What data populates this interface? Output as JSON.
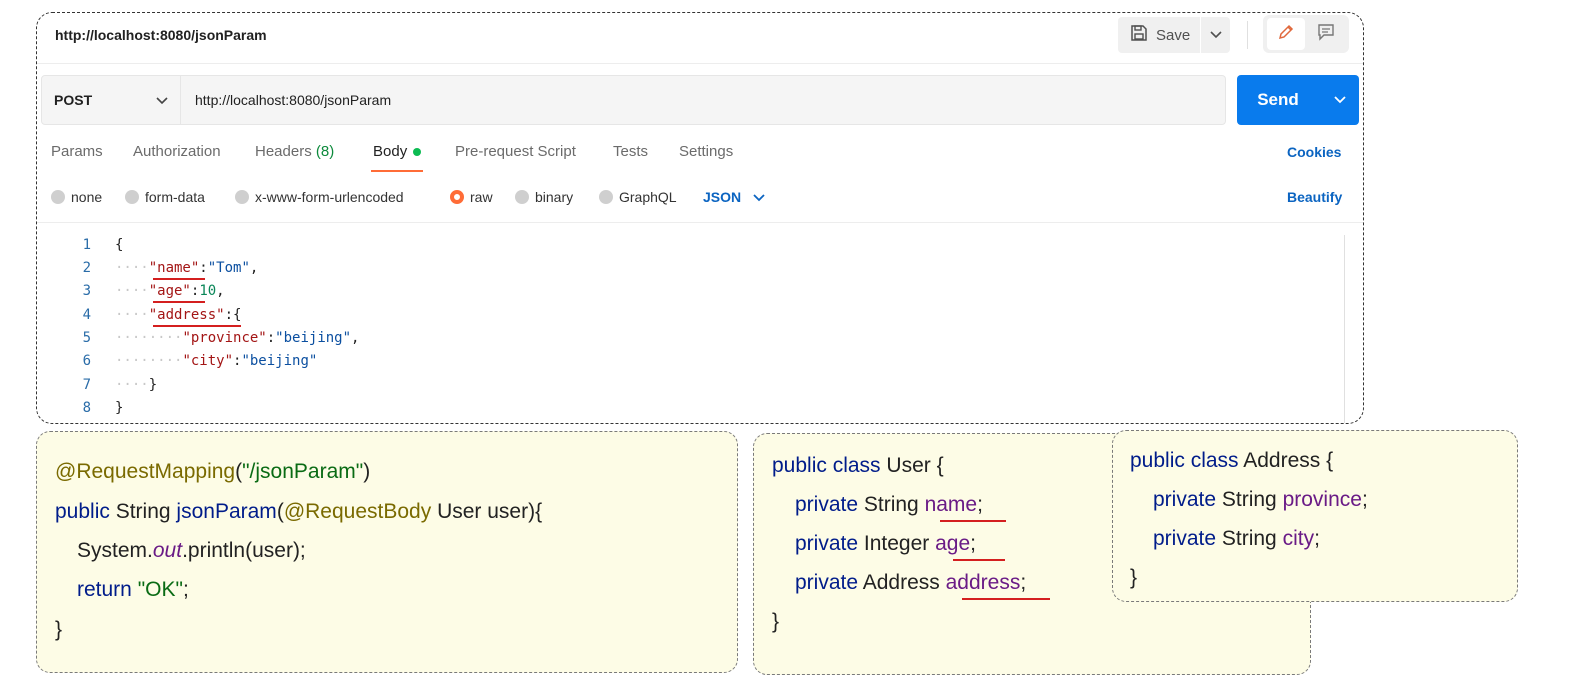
{
  "request": {
    "title": "http://localhost:8080/jsonParam",
    "method": "POST",
    "url": "http://localhost:8080/jsonParam",
    "save_label": "Save",
    "send_label": "Send"
  },
  "tabs": [
    {
      "label": "Params"
    },
    {
      "label": "Authorization"
    },
    {
      "label": "Headers",
      "count": "(8)"
    },
    {
      "label": "Body",
      "active": true
    },
    {
      "label": "Pre-request Script"
    },
    {
      "label": "Tests"
    },
    {
      "label": "Settings"
    }
  ],
  "cookies_label": "Cookies",
  "body_types": [
    {
      "label": "none"
    },
    {
      "label": "form-data"
    },
    {
      "label": "x-www-form-urlencoded"
    },
    {
      "label": "raw",
      "selected": true
    },
    {
      "label": "binary"
    },
    {
      "label": "GraphQL"
    }
  ],
  "format_label": "JSON",
  "beautify_label": "Beautify",
  "editor": {
    "line_numbers": [
      "1",
      "2",
      "3",
      "4",
      "5",
      "6",
      "7",
      "8"
    ],
    "tokens": {
      "open": "{",
      "name_key": "\"name\"",
      "name_val": "\"Tom\"",
      "age_key": "\"age\"",
      "age_val": "10",
      "address_key": "\"address\"",
      "province_key": "\"province\"",
      "province_val": "\"beijing\"",
      "city_key": "\"city\"",
      "city_val": "\"beijing\"",
      "close_inner": "}",
      "close": "}"
    }
  },
  "controller_code": {
    "annotation": "@RequestMapping",
    "mapping_path": "\"/jsonParam\"",
    "kw_public": "public",
    "type_string": "String",
    "method_name": "jsonParam",
    "param_annotation": "@RequestBody",
    "param": "User user",
    "system": "System.",
    "out": "out",
    "println": ".println(user);",
    "kw_return": "return",
    "ok": "\"OK\"",
    "close": "}"
  },
  "user_class": {
    "kw_public_class": "public class",
    "class_name": "User {",
    "kw_private": "private",
    "f1_type": "String",
    "f1_name": "name",
    "f2_type": "Integer",
    "f2_name": "age",
    "f3_type": "Address",
    "f3_name": "address",
    "close": "}"
  },
  "address_class": {
    "kw_public_class": "public class",
    "class_name": "Address {",
    "kw_private": "private",
    "f1_type": "String",
    "f1_name": "province",
    "f2_type": "String",
    "f2_name": "city",
    "close": "}"
  },
  "colors": {
    "send": "#097bed",
    "active_tab_underline": "#ff6c37",
    "link": "#0b64c1",
    "card_bg": "#fdfce6",
    "annotation_underline": "#d41f1f"
  }
}
